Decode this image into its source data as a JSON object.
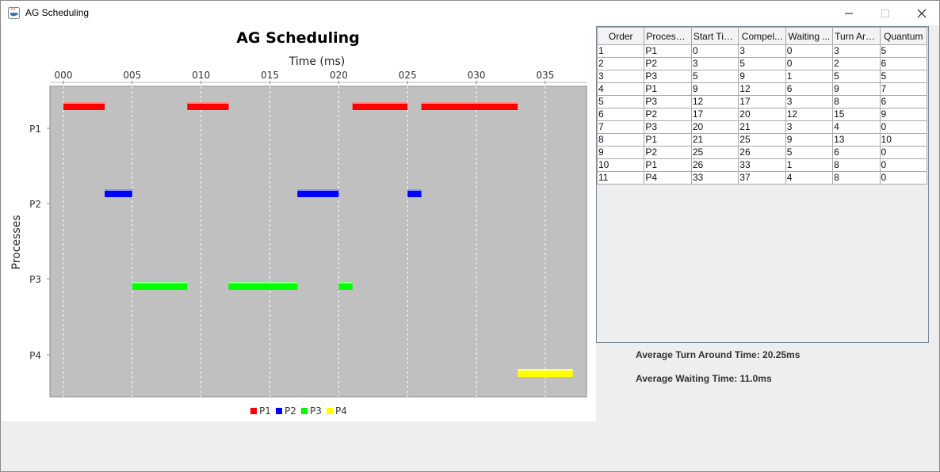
{
  "window": {
    "title": "AG Scheduling"
  },
  "colors": {
    "P1": "#ff0000",
    "P2": "#0000ff",
    "P3": "#00ff00",
    "P4": "#ffff00",
    "plot_bg": "#c0c0c0"
  },
  "chart_data": {
    "type": "gantt",
    "title": "AG Scheduling",
    "xlabel": "Time (ms)",
    "ylabel": "Processes",
    "xlim": [
      -1,
      38
    ],
    "xticks": [
      "000",
      "005",
      "010",
      "015",
      "020",
      "025",
      "030",
      "035"
    ],
    "xtick_values": [
      0,
      5,
      10,
      15,
      20,
      25,
      30,
      35
    ],
    "categories": [
      "P1",
      "P2",
      "P3",
      "P4"
    ],
    "grid": true,
    "legend_position": "bottom",
    "series": [
      {
        "name": "P1",
        "segments": [
          [
            0,
            3
          ],
          [
            9,
            12
          ],
          [
            21,
            25
          ],
          [
            26,
            33
          ]
        ]
      },
      {
        "name": "P2",
        "segments": [
          [
            3,
            5
          ],
          [
            17,
            20
          ],
          [
            25,
            26
          ]
        ]
      },
      {
        "name": "P3",
        "segments": [
          [
            5,
            9
          ],
          [
            12,
            17
          ],
          [
            20,
            21
          ]
        ]
      },
      {
        "name": "P4",
        "segments": [
          [
            33,
            37
          ]
        ]
      }
    ]
  },
  "table": {
    "columns": [
      "Order",
      "Process ...",
      "Start Time",
      "Compel...",
      "Waiting ...",
      "Turn Aro...",
      "Quantum"
    ],
    "rows": [
      [
        "1",
        "P1",
        "0",
        "3",
        "0",
        "3",
        "5"
      ],
      [
        "2",
        "P2",
        "3",
        "5",
        "0",
        "2",
        "6"
      ],
      [
        "3",
        "P3",
        "5",
        "9",
        "1",
        "5",
        "5"
      ],
      [
        "4",
        "P1",
        "9",
        "12",
        "6",
        "9",
        "7"
      ],
      [
        "5",
        "P3",
        "12",
        "17",
        "3",
        "8",
        "6"
      ],
      [
        "6",
        "P2",
        "17",
        "20",
        "12",
        "15",
        "9"
      ],
      [
        "7",
        "P3",
        "20",
        "21",
        "3",
        "4",
        "0"
      ],
      [
        "8",
        "P1",
        "21",
        "25",
        "9",
        "13",
        "10"
      ],
      [
        "9",
        "P2",
        "25",
        "26",
        "5",
        "6",
        "0"
      ],
      [
        "10",
        "P1",
        "26",
        "33",
        "1",
        "8",
        "0"
      ],
      [
        "11",
        "P4",
        "33",
        "37",
        "4",
        "8",
        "0"
      ]
    ]
  },
  "stats": {
    "avg_turnaround": "Average Turn Around Time: 20.25ms",
    "avg_waiting": "Average Waiting Time: 11.0ms"
  },
  "icons": {
    "app": "java-cup-icon",
    "minimize": "minimize-icon",
    "maximize": "maximize-icon",
    "close": "close-icon"
  }
}
